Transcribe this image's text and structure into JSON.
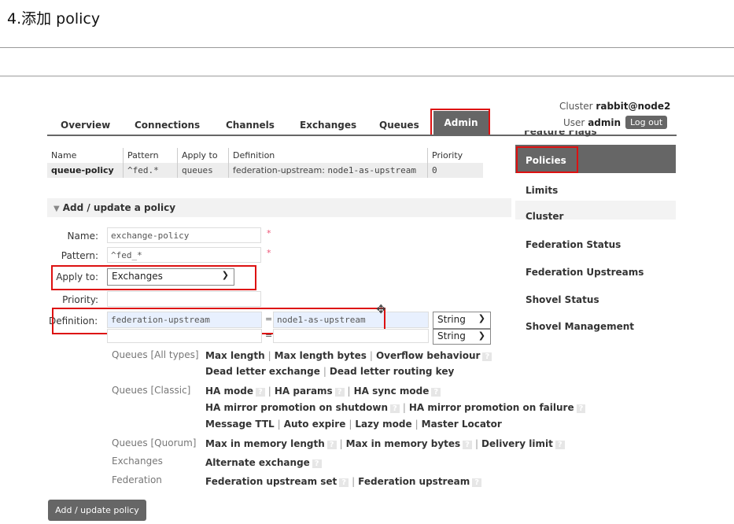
{
  "doc_title": "4.添加 policy",
  "nav": {
    "tabs": [
      "Overview",
      "Connections",
      "Channels",
      "Exchanges",
      "Queues",
      "Admin"
    ],
    "cluster_label": "Cluster",
    "cluster_name": "rabbit@node2",
    "user_label": "User",
    "user_name": "admin",
    "logout": "Log out"
  },
  "sidebar": {
    "clipped": "Feature Flags",
    "items": [
      "Policies",
      "Limits",
      "Cluster",
      "Federation Status",
      "Federation Upstreams",
      "Shovel Status",
      "Shovel Management"
    ]
  },
  "policies_table": {
    "headers": [
      "Name",
      "Pattern",
      "Apply to",
      "Definition",
      "Priority"
    ],
    "rows": [
      {
        "name": "queue-policy",
        "pattern": "^fed.*",
        "apply_to": "queues",
        "def_key": "federation-upstream:",
        "def_value": "node1-as-upstream",
        "priority": "0"
      }
    ]
  },
  "form": {
    "section_title": "Add / update a policy",
    "name_label": "Name:",
    "name_value": "exchange-policy",
    "pattern_label": "Pattern:",
    "pattern_value": "^fed_*",
    "apply_label": "Apply to:",
    "apply_value": "Exchanges",
    "priority_label": "Priority:",
    "priority_value": "",
    "definition_label": "Definition:",
    "def_key": "federation-upstream",
    "def_value": "node1-as-upstream",
    "def_type": "String",
    "def_type2": "String",
    "equals": "=",
    "required": "*"
  },
  "help": {
    "groups": [
      "Queues [All types]",
      "Queues [Classic]",
      "Queues [Quorum]",
      "Exchanges",
      "Federation"
    ],
    "all_line1": [
      "Max length",
      "Max length bytes",
      "Overflow behaviour"
    ],
    "all_line2": [
      "Dead letter exchange",
      "Dead letter routing key"
    ],
    "classic_line1": [
      "HA mode",
      "HA params",
      "HA sync mode"
    ],
    "classic_line2": [
      "HA mirror promotion on shutdown",
      "HA mirror promotion on failure"
    ],
    "classic_line3": [
      "Message TTL",
      "Auto expire",
      "Lazy mode",
      "Master Locator"
    ],
    "quorum_line": [
      "Max in memory length",
      "Max in memory bytes",
      "Delivery limit"
    ],
    "exchanges_line": [
      "Alternate exchange"
    ],
    "federation_line": [
      "Federation upstream set",
      "Federation upstream"
    ],
    "q": "?",
    "sep": "|"
  },
  "submit": "Add / update policy"
}
